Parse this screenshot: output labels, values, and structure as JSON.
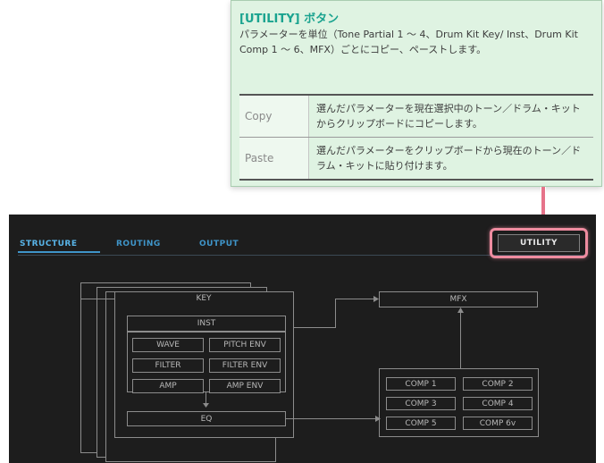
{
  "callout": {
    "title": "[UTILITY] ボタン",
    "description": "パラメーターを単位（Tone Partial 1 ～ 4、Drum Kit Key/ Inst、Drum Kit Comp 1 ～ 6、MFX）ごとにコピー、ペーストします。",
    "rows": [
      {
        "name": "Copy",
        "desc": "選んだパラメーターを現在選択中のトーン／ドラム・キットからクリップボードにコピーします。"
      },
      {
        "name": "Paste",
        "desc": "選んだパラメーターをクリップボードから現在のトーン／ドラム・キットに貼り付けます。"
      }
    ]
  },
  "tabs": [
    "STRUCTURE",
    "ROUTING",
    "OUTPUT"
  ],
  "utility_label": "UTILITY",
  "diagram": {
    "key": "KEY",
    "inst": "INST",
    "wave": "WAVE",
    "pitch_env": "PITCH ENV",
    "filter": "FILTER",
    "filter_env": "FILTER ENV",
    "amp": "AMP",
    "amp_env": "AMP ENV",
    "eq": "EQ",
    "mfx": "MFX",
    "comp1": "COMP 1",
    "comp2": "COMP 2",
    "comp3": "COMP 3",
    "comp4": "COMP 4",
    "comp5": "COMP 5",
    "comp6": "COMP 6v"
  },
  "colors": {
    "callout_bg": "#dff3e2",
    "callout_title": "#1aa38f",
    "panel_bg": "#1d1d1d",
    "tab_blue": "#3f95c9",
    "highlight_pink": "#ee8ca0"
  }
}
